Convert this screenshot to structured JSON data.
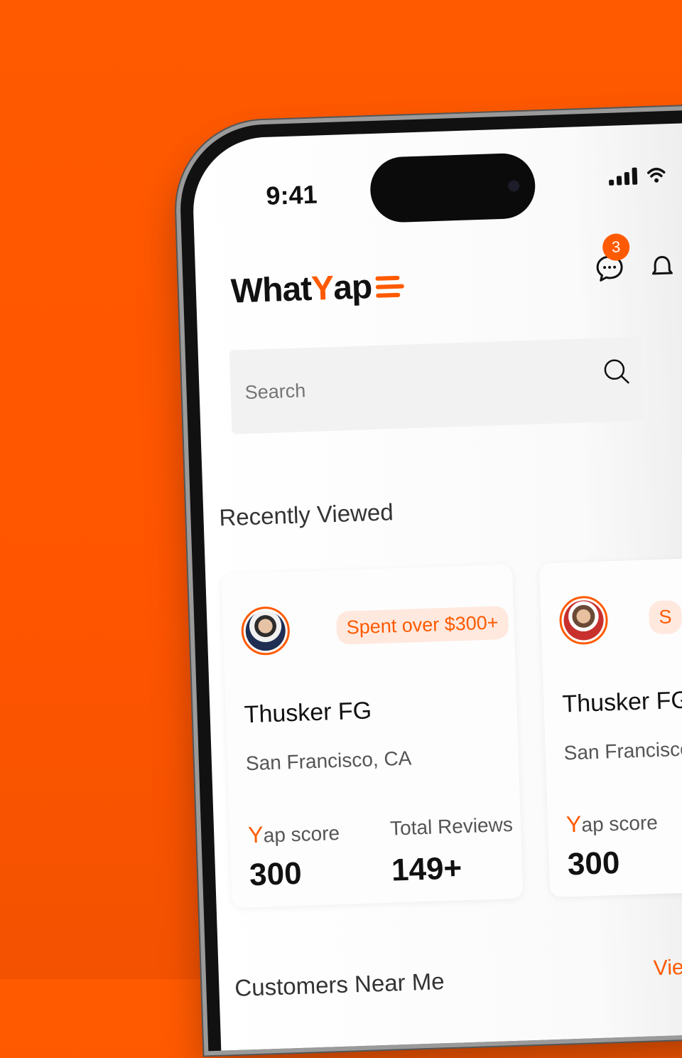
{
  "status": {
    "time": "9:41"
  },
  "brand": {
    "pre": "What",
    "y": "Y",
    "post": "ap"
  },
  "header": {
    "chat_badge": "3"
  },
  "search": {
    "placeholder": "Search"
  },
  "recent": {
    "title": "Recently Viewed",
    "cards": [
      {
        "tag": "Spent over $300+",
        "name": "Thusker FG",
        "location": "San Francisco, CA",
        "score_prefix": "Y",
        "score_label": "ap score",
        "score": "300",
        "reviews_label": "Total Reviews",
        "reviews": "149+"
      },
      {
        "tag": "S",
        "name": "Thusker FG",
        "location": "San Francisco,",
        "score_prefix": "Y",
        "score_label": "ap score",
        "score": "300"
      }
    ]
  },
  "near": {
    "title": "Customers Near Me",
    "view_link": "Vie"
  },
  "colors": {
    "accent": "#ff5a00",
    "tag_bg": "#ffe9df"
  }
}
